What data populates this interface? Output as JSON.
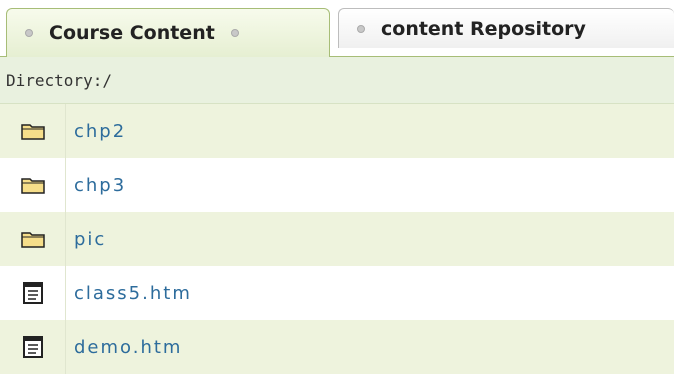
{
  "tabs": {
    "active": "Course Content",
    "inactive": "content Repository"
  },
  "directory": {
    "label": "Directory:/"
  },
  "entries": [
    {
      "name": "chp2",
      "icon": "folder-icon"
    },
    {
      "name": "chp3",
      "icon": "folder-icon"
    },
    {
      "name": "pic",
      "icon": "folder-icon"
    },
    {
      "name": "class5.htm",
      "icon": "file-icon"
    },
    {
      "name": "demo.htm",
      "icon": "file-icon"
    }
  ]
}
